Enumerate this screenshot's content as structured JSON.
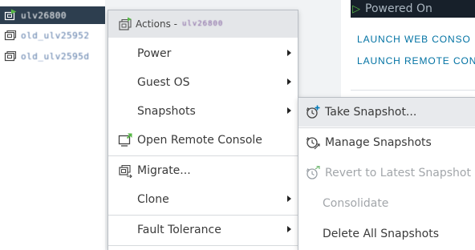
{
  "inventory": {
    "items": [
      {
        "name": "ulv26800",
        "selected": true
      },
      {
        "name": "old_ulv25952",
        "selected": false
      },
      {
        "name": "old_ulv2595d",
        "selected": false
      }
    ]
  },
  "summary": {
    "power_state": "Powered On",
    "launch_web_console": "LAUNCH WEB CONSO",
    "launch_remote_console": "LAUNCH REMOTE CON"
  },
  "context_menu": {
    "header": {
      "label": "Actions -",
      "target": "ulv26800",
      "icon": "vm-icon"
    },
    "items": [
      {
        "id": "power",
        "label": "Power",
        "submenu": true
      },
      {
        "id": "guest-os",
        "label": "Guest OS",
        "submenu": true
      },
      {
        "id": "snapshots",
        "label": "Snapshots",
        "submenu": true
      },
      {
        "id": "open-remote-console",
        "label": "Open Remote Console",
        "icon": "remote-console-icon"
      },
      {
        "id": "migrate",
        "label": "Migrate...",
        "icon": "migrate-icon"
      },
      {
        "id": "clone",
        "label": "Clone",
        "submenu": true
      },
      {
        "id": "fault-tolerance",
        "label": "Fault Tolerance",
        "submenu": true
      }
    ]
  },
  "snapshots_submenu": {
    "items": [
      {
        "id": "take-snapshot",
        "label": "Take Snapshot...",
        "icon": "take-snapshot-icon",
        "hover": true
      },
      {
        "id": "manage-snapshots",
        "label": "Manage Snapshots",
        "icon": "manage-snapshots-icon"
      },
      {
        "id": "revert-snapshot",
        "label": "Revert to Latest Snapshot",
        "icon": "revert-snapshot-icon",
        "disabled": true
      },
      {
        "id": "consolidate",
        "label": "Consolidate",
        "disabled": true
      },
      {
        "id": "delete-all-snapshots",
        "label": "Delete All Snapshots"
      }
    ]
  },
  "colors": {
    "selected_row": "#2d3e4f",
    "link": "#0072a3",
    "power_on": "#57b846",
    "menu_header": "#e4e6e9"
  }
}
